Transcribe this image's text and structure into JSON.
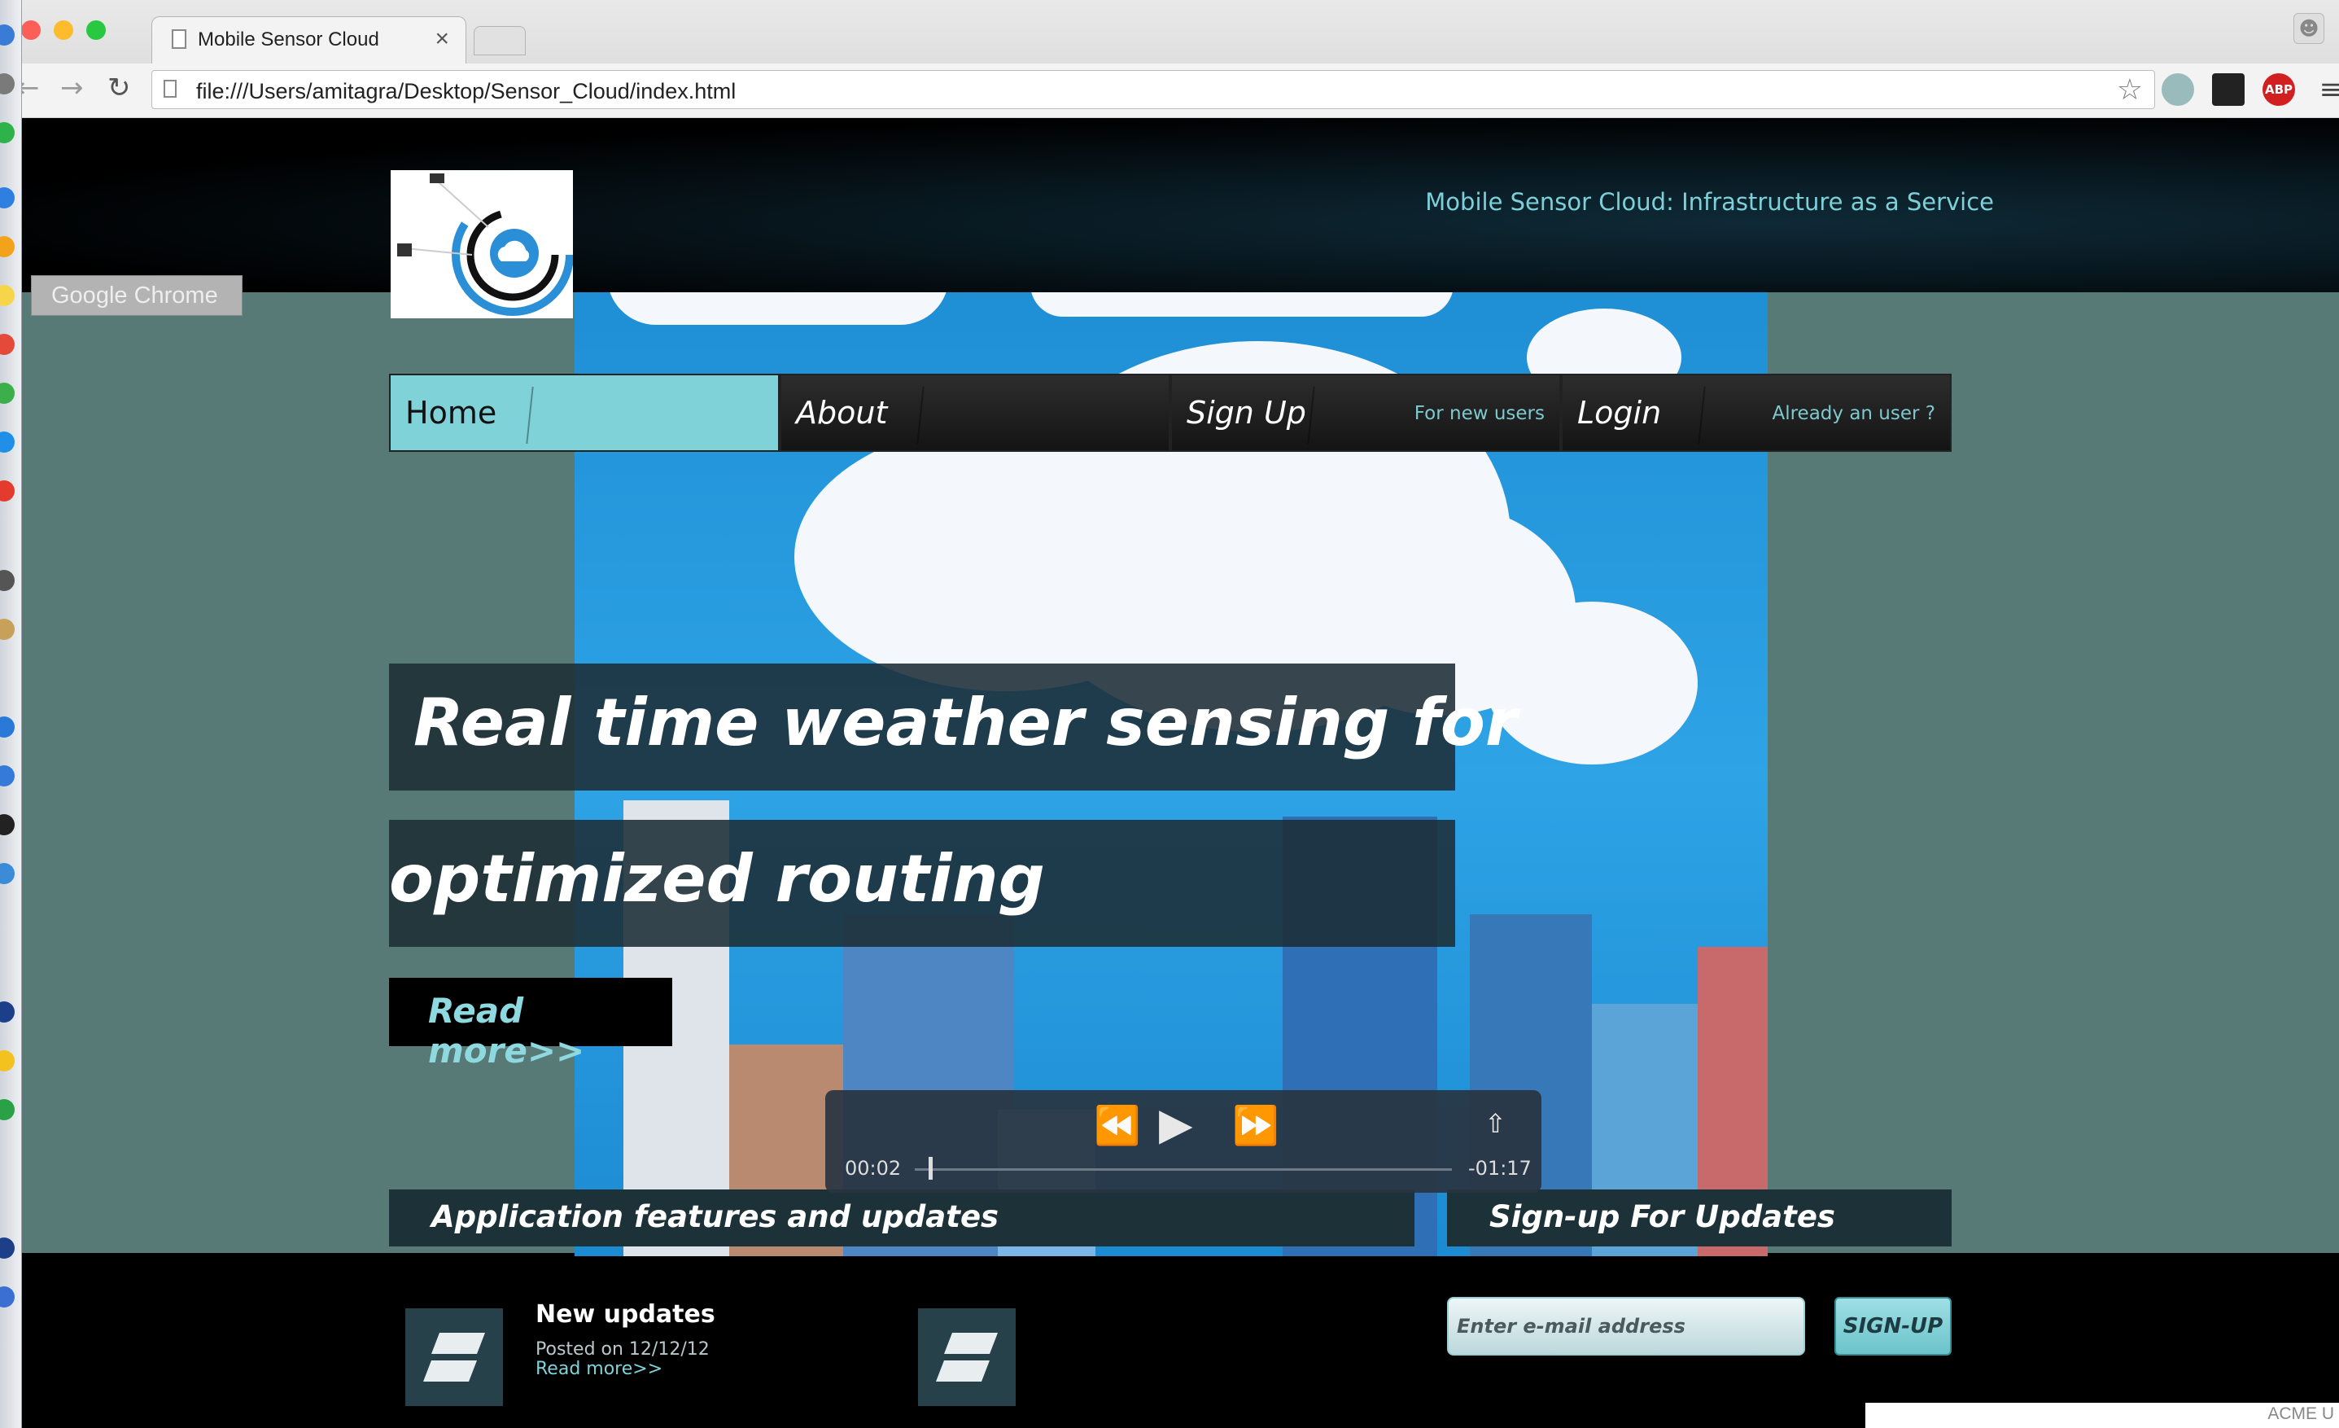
{
  "browser": {
    "tab_title": "Mobile Sensor Cloud",
    "tab_close": "×",
    "url": "file:///Users/amitagra/Desktop/Sensor_Cloud/index.html",
    "extension_abp": "ABP",
    "tooltip": "Google Chrome"
  },
  "site": {
    "tagline": "Mobile Sensor Cloud: Infrastructure as a Service",
    "nav": [
      {
        "label": "Home",
        "sub": ""
      },
      {
        "label": "About",
        "sub": ""
      },
      {
        "label": "Sign Up",
        "sub": "For new users"
      },
      {
        "label": "Login",
        "sub": "Already an user ?"
      }
    ],
    "headline_line1": "Real time weather sensing for",
    "headline_line2": "optimized routing",
    "read_more": "Read more>>"
  },
  "video": {
    "elapsed": "00:02",
    "remaining": "-01:17",
    "progress": 0.025
  },
  "features": {
    "heading": "Application features and updates",
    "item_title": "New updates",
    "item_posted": "Posted on 12/12/12",
    "item_more": "Read more>>"
  },
  "signup": {
    "heading": "Sign-up For Updates",
    "email_placeholder": "Enter e-mail address",
    "button": "SIGN-UP"
  },
  "status_text": "ACME U"
}
